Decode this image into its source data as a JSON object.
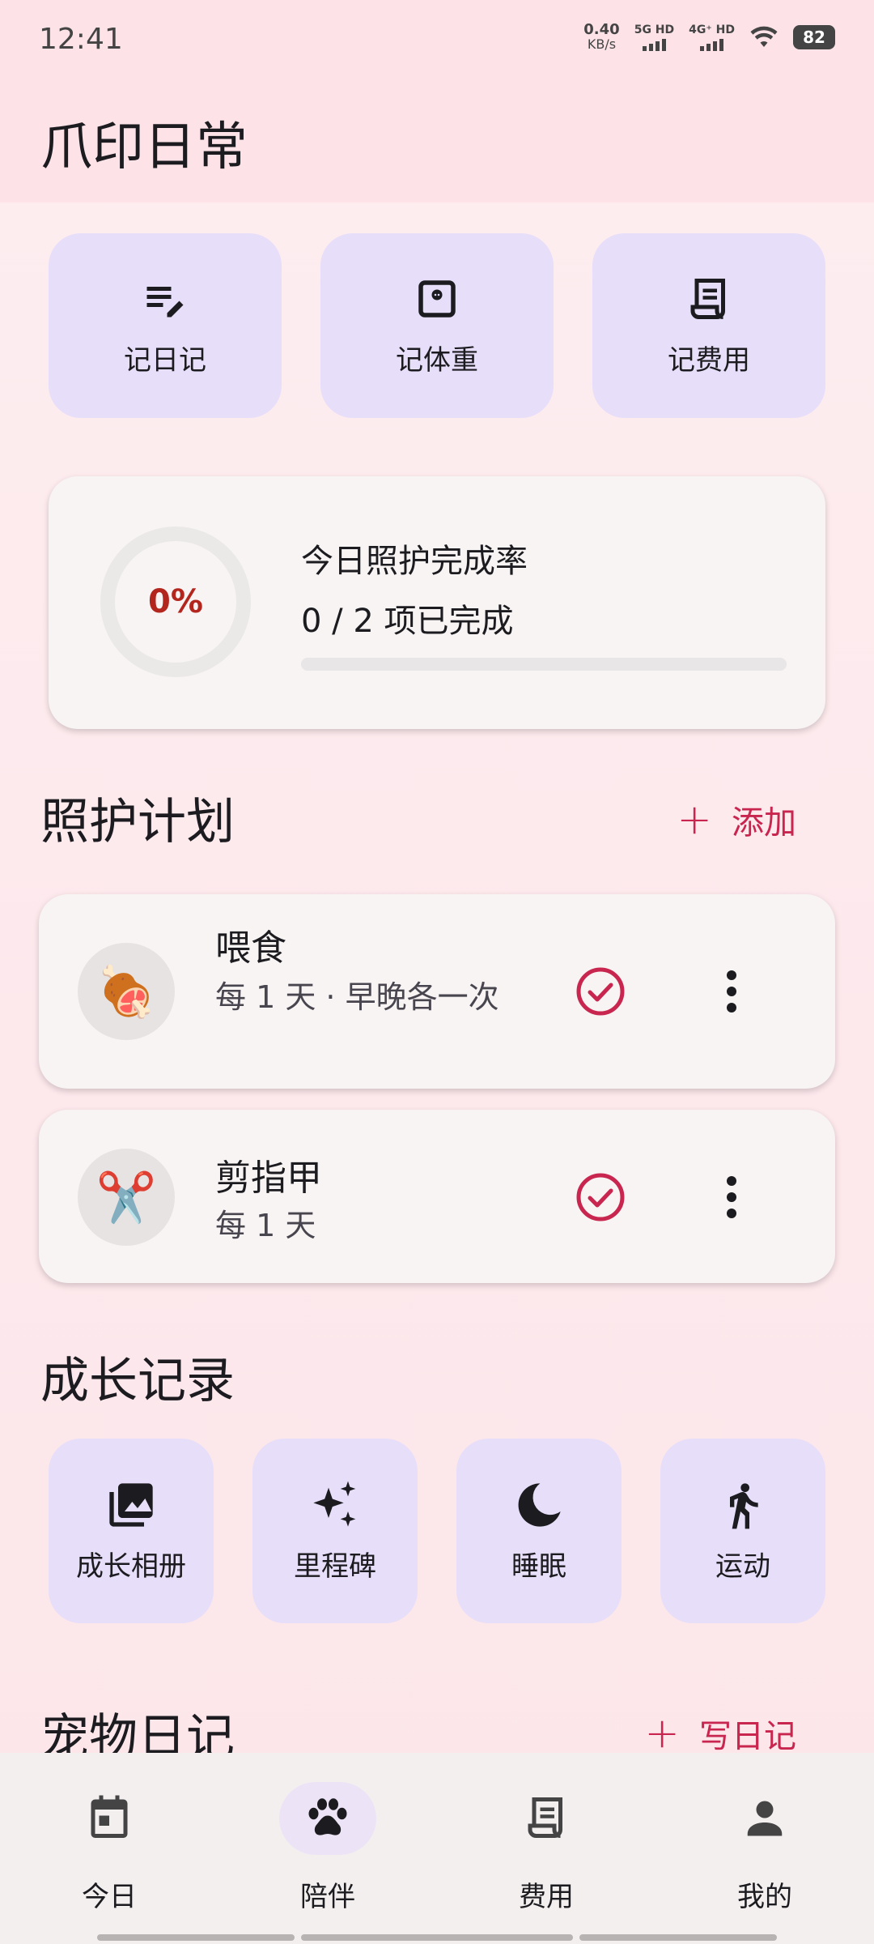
{
  "status_bar": {
    "time": "12:41",
    "net_speed_value": "0.40",
    "net_speed_unit": "KB/s",
    "sim1": "5G HD",
    "sim2": "4G⁺ HD",
    "battery": "82"
  },
  "app": {
    "title": "爪印日常"
  },
  "quick_actions": [
    {
      "label": "记日记",
      "icon": "edit-note-icon"
    },
    {
      "label": "记体重",
      "icon": "scale-icon"
    },
    {
      "label": "记费用",
      "icon": "receipt-icon"
    }
  ],
  "progress_card": {
    "percent_text": "0%",
    "title": "今日照护完成率",
    "summary": "0 / 2 项已完成",
    "completed": 0,
    "total": 2
  },
  "care_plan": {
    "title": "照护计划",
    "add_label": "添加",
    "items": [
      {
        "name": "喂食",
        "desc": "每 1 天 · 早晚各一次",
        "emoji": "🍖",
        "icon": "meat-icon"
      },
      {
        "name": "剪指甲",
        "desc": "每 1 天",
        "emoji": "✂️",
        "icon": "scissors-icon"
      }
    ]
  },
  "growth": {
    "title": "成长记录",
    "tiles": [
      {
        "label": "成长相册",
        "icon": "photo-library-icon"
      },
      {
        "label": "里程碑",
        "icon": "sparkle-icon"
      },
      {
        "label": "睡眠",
        "icon": "moon-icon"
      },
      {
        "label": "运动",
        "icon": "walking-icon"
      }
    ]
  },
  "diary": {
    "title": "宠物日记",
    "write_label": "写日记"
  },
  "bottom_nav": {
    "active": 1,
    "items": [
      {
        "label": "今日",
        "icon": "calendar-icon"
      },
      {
        "label": "陪伴",
        "icon": "paw-icon"
      },
      {
        "label": "费用",
        "icon": "receipt-icon"
      },
      {
        "label": "我的",
        "icon": "person-icon"
      }
    ]
  },
  "colors": {
    "accent": "#c8254f",
    "tile_bg": "#e7def9",
    "card_bg": "#f7f4f3",
    "header_bg": "#fde3e8"
  }
}
